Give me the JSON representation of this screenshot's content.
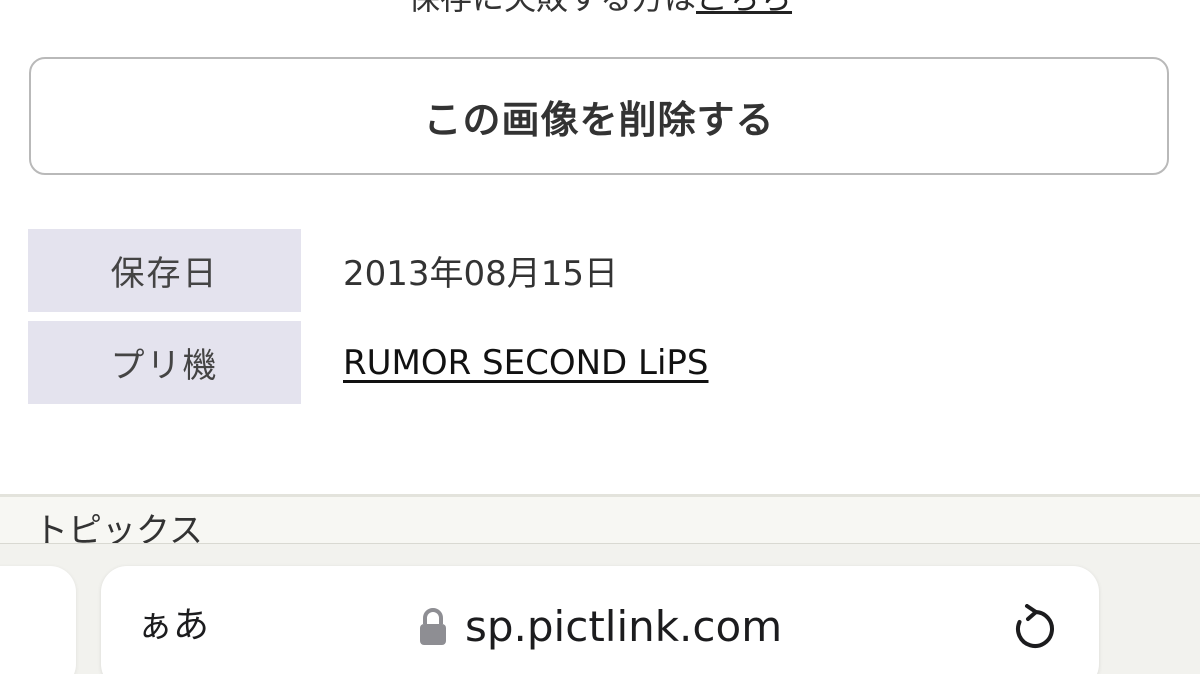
{
  "top_note": {
    "text": "保存に失敗する方は",
    "link": "こちら"
  },
  "delete_button": {
    "label": "この画像を削除する"
  },
  "info": {
    "rows": [
      {
        "label": "保存日",
        "value": "2013年08月15日"
      },
      {
        "label": "プリ機",
        "value": "RUMOR SECOND LiPS"
      }
    ]
  },
  "topics": {
    "title": "トピックス"
  },
  "browser": {
    "aa_label": "ぁあ",
    "url": "sp.pictlink.com",
    "icons": {
      "lock": "lock-icon",
      "reload": "reload-icon"
    }
  },
  "colors": {
    "label_bg": "#e4e3ee",
    "button_border": "#b9b9b9",
    "toolbar_bg": "#f2f2ee",
    "icon_gray": "#8e8e93"
  }
}
